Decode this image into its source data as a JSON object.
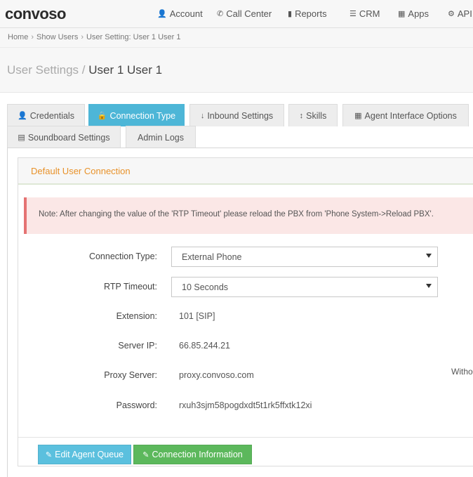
{
  "topnav": {
    "logo": "CONVOSO",
    "items": [
      {
        "label": "Account",
        "icon": "user-icon",
        "glyph": "👤"
      },
      {
        "label": "Call Center",
        "icon": "phone-icon",
        "glyph": "✆"
      },
      {
        "label": "Reports",
        "icon": "bar-chart-icon",
        "glyph": "▮"
      },
      {
        "label": "CRM",
        "icon": "list-icon",
        "glyph": "☰"
      },
      {
        "label": "Apps",
        "icon": "grid-icon",
        "glyph": "▦"
      },
      {
        "label": "API",
        "icon": "gear-icon",
        "glyph": "⚙"
      }
    ]
  },
  "breadcrumb": {
    "items": [
      "Home",
      "Show Users",
      "User Setting: User 1 User 1"
    ],
    "separator": "›"
  },
  "page": {
    "title_prefix": "User Settings /",
    "title_name": "User 1 User 1"
  },
  "tabs": [
    {
      "label": "Credentials",
      "icon": "user-icon",
      "glyph": "👤",
      "active": false
    },
    {
      "label": "Connection Type",
      "icon": "lock-icon",
      "glyph": "🔒",
      "active": true
    },
    {
      "label": "Inbound Settings",
      "icon": "arrow-down-icon",
      "glyph": "↓",
      "active": false
    },
    {
      "label": "Skills",
      "icon": "arrows-vertical-icon",
      "glyph": "↕",
      "active": false
    },
    {
      "label": "Agent Interface Options",
      "icon": "grid-icon",
      "glyph": "▦",
      "active": false
    },
    {
      "label": "Soundboard Settings",
      "icon": "sound-file-icon",
      "glyph": "▤",
      "active": false
    },
    {
      "label": "Admin Logs",
      "icon": "",
      "glyph": "",
      "active": false
    }
  ],
  "panel": {
    "title": "Default User Connection",
    "note": "Note: After changing the value of the 'RTP Timeout' please reload the PBX from 'Phone System->Reload PBX'."
  },
  "form": {
    "connection_type": {
      "label": "Connection Type:",
      "value": "External Phone"
    },
    "rtp_timeout": {
      "label": "RTP Timeout:",
      "value": "10 Seconds"
    },
    "extension": {
      "label": "Extension:",
      "value": "101 [SIP]"
    },
    "server_ip": {
      "label": "Server IP:",
      "value": "66.85.244.21"
    },
    "proxy_server": {
      "label": "Proxy Server:",
      "value": "proxy.convoso.com",
      "side_text": "Witho"
    },
    "password": {
      "label": "Password:",
      "value": "rxuh3sjm58pogdxdt5t1rk5ffxtk12xi"
    }
  },
  "buttons": {
    "edit_agent_queue": {
      "label": "Edit Agent Queue",
      "icon": "edit-icon",
      "glyph": "✎"
    },
    "connection_information": {
      "label": "Connection Information",
      "icon": "edit-icon",
      "glyph": "✎"
    }
  },
  "colors": {
    "accent_blue": "#4db6d7",
    "button_blue": "#5bc0de",
    "button_green": "#5cb85c",
    "panel_title_orange": "#e8922a",
    "note_background": "#fbe7e6",
    "note_border": "#e57373"
  }
}
